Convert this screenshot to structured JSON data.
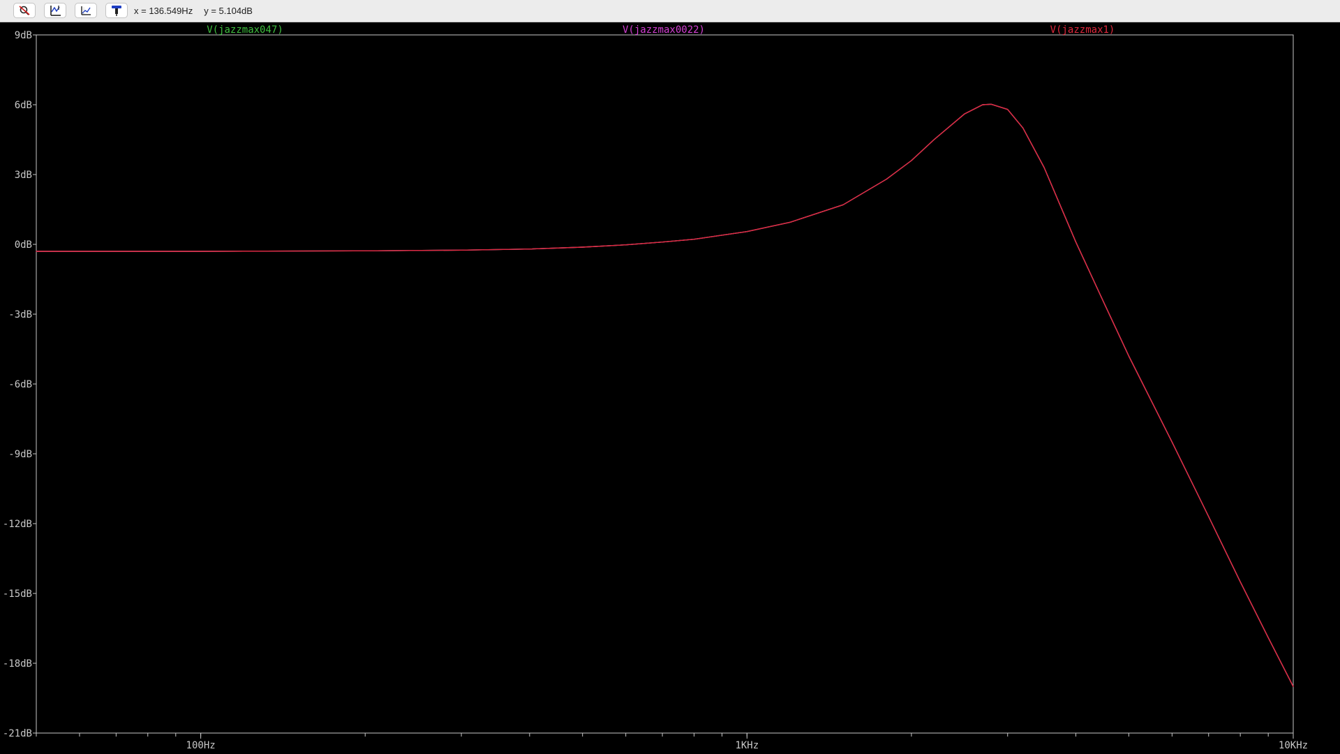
{
  "toolbar": {
    "buttons": [
      {
        "icon": "zoom-cancel-icon"
      },
      {
        "icon": "autorange-icon"
      },
      {
        "icon": "grid-icon"
      },
      {
        "icon": "probe-icon"
      }
    ],
    "cursor_x": "x = 136.549Hz",
    "cursor_y": "y = 5.104dB"
  },
  "colors": {
    "background": "#000000",
    "axis": "#c8c8c8",
    "series_green": "#3fbf3f",
    "series_magenta": "#d43fd4",
    "series_red": "#e0283c"
  },
  "chart_data": {
    "type": "line",
    "x_scale": "log",
    "xlim": [
      50,
      10000
    ],
    "ylim": [
      -21,
      9
    ],
    "x_ticks": [
      {
        "value": 100,
        "label": "100Hz"
      },
      {
        "value": 1000,
        "label": "1KHz"
      },
      {
        "value": 10000,
        "label": "10KHz"
      }
    ],
    "y_ticks": [
      {
        "value": 9,
        "label": "9dB"
      },
      {
        "value": 6,
        "label": "6dB"
      },
      {
        "value": 3,
        "label": "3dB"
      },
      {
        "value": 0,
        "label": "0dB"
      },
      {
        "value": -3,
        "label": "-3dB"
      },
      {
        "value": -6,
        "label": "-6dB"
      },
      {
        "value": -9,
        "label": "-9dB"
      },
      {
        "value": -12,
        "label": "-12dB"
      },
      {
        "value": -15,
        "label": "-15dB"
      },
      {
        "value": -18,
        "label": "-18dB"
      },
      {
        "value": -21,
        "label": "-21dB"
      }
    ],
    "grid": false,
    "legend_position": "top",
    "series": [
      {
        "name": "V(jazzmax047)",
        "color": "#3fbf3f",
        "x": [
          50,
          100,
          200,
          300,
          400,
          500,
          600,
          700,
          800,
          1000,
          1200,
          1500,
          1800,
          2000,
          2200,
          2500,
          2700,
          2800,
          3000,
          3200,
          3500,
          4000,
          4500,
          5000,
          6000,
          7000,
          8000,
          9000,
          10000
        ],
        "y": [
          -0.3,
          -0.3,
          -0.28,
          -0.25,
          -0.2,
          -0.12,
          -0.02,
          0.1,
          0.22,
          0.55,
          0.95,
          1.7,
          2.8,
          3.6,
          4.5,
          5.6,
          6.0,
          6.02,
          5.8,
          5.0,
          3.3,
          0.1,
          -2.5,
          -4.8,
          -8.5,
          -11.7,
          -14.5,
          -16.9,
          -19.0
        ]
      },
      {
        "name": "V(jazzmax0022)",
        "color": "#d43fd4",
        "x": [
          50,
          100,
          200,
          300,
          400,
          500,
          600,
          700,
          800,
          1000,
          1200,
          1500,
          1800,
          2000,
          2200,
          2500,
          2700,
          2800,
          3000,
          3200,
          3500,
          4000,
          4500,
          5000,
          6000,
          7000,
          8000,
          9000,
          10000
        ],
        "y": [
          -0.3,
          -0.3,
          -0.28,
          -0.25,
          -0.2,
          -0.12,
          -0.02,
          0.1,
          0.22,
          0.55,
          0.95,
          1.7,
          2.8,
          3.6,
          4.5,
          5.6,
          6.0,
          6.02,
          5.8,
          5.0,
          3.3,
          0.1,
          -2.5,
          -4.8,
          -8.5,
          -11.7,
          -14.5,
          -16.9,
          -19.0
        ]
      },
      {
        "name": "V(jazzmax1)",
        "color": "#e0283c",
        "x": [
          50,
          100,
          200,
          300,
          400,
          500,
          600,
          700,
          800,
          1000,
          1200,
          1500,
          1800,
          2000,
          2200,
          2500,
          2700,
          2800,
          3000,
          3200,
          3500,
          4000,
          4500,
          5000,
          6000,
          7000,
          8000,
          9000,
          10000
        ],
        "y": [
          -0.3,
          -0.3,
          -0.28,
          -0.25,
          -0.2,
          -0.12,
          -0.02,
          0.1,
          0.22,
          0.55,
          0.95,
          1.7,
          2.8,
          3.6,
          4.5,
          5.6,
          6.0,
          6.02,
          5.8,
          5.0,
          3.3,
          0.1,
          -2.5,
          -4.8,
          -8.5,
          -11.7,
          -14.5,
          -16.9,
          -19.0
        ]
      }
    ]
  }
}
